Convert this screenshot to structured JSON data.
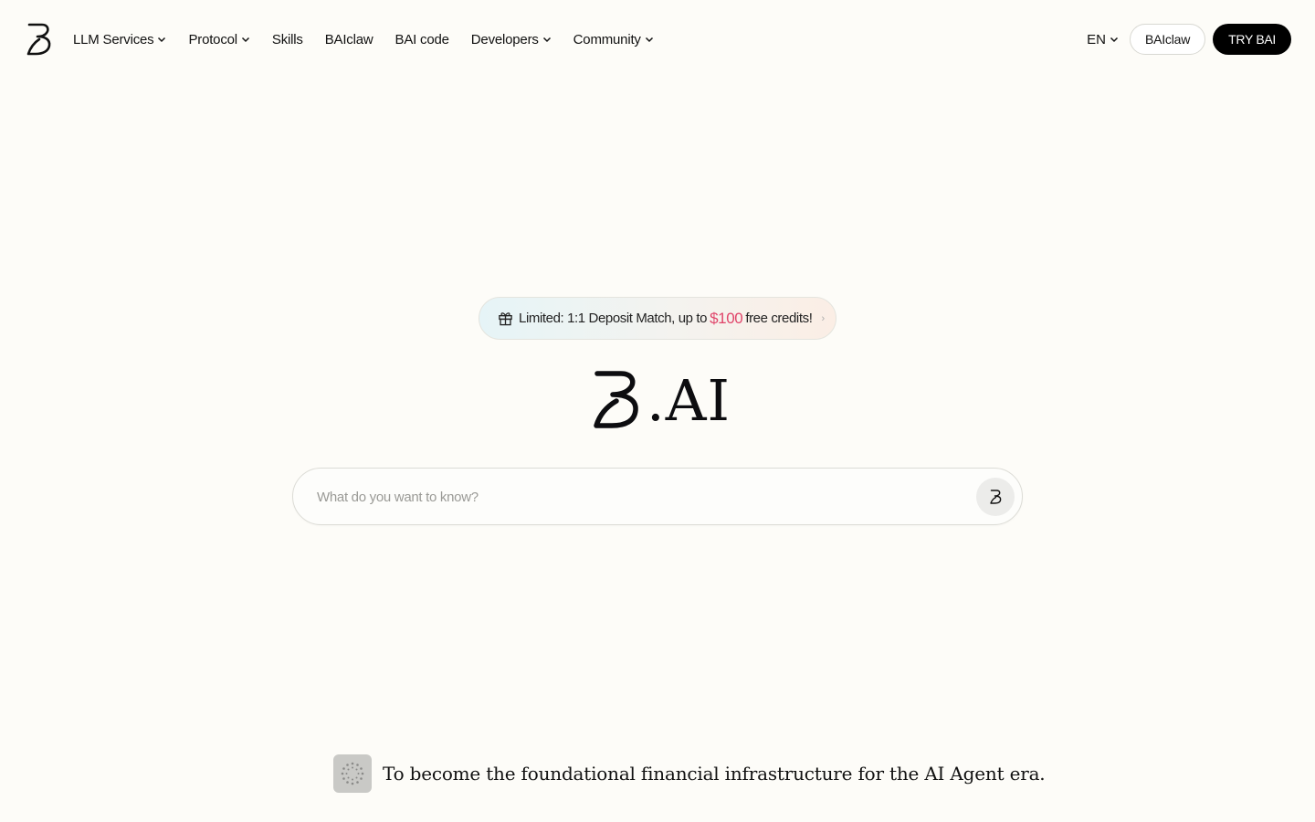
{
  "header": {
    "logo_icon": "b-logo-icon",
    "nav": [
      {
        "label": "LLM Services",
        "dropdown": true
      },
      {
        "label": "Protocol",
        "dropdown": true
      },
      {
        "label": "Skills",
        "dropdown": false
      },
      {
        "label": "BAIclaw",
        "dropdown": false
      },
      {
        "label": "BAI code",
        "dropdown": false
      },
      {
        "label": "Developers",
        "dropdown": true
      },
      {
        "label": "Community",
        "dropdown": true
      }
    ],
    "language": "EN",
    "baiclaw_button": "BAIclaw",
    "try_button": "TRY BAI"
  },
  "promo": {
    "prefix": "Limited: 1:1 Deposit Match, up to",
    "amount": "$100",
    "suffix": "free credits!",
    "icon": "gift-icon",
    "arrow_icon": "chevron-right-icon",
    "amount_color": "#e0456a"
  },
  "brand": {
    "text": ".AI",
    "icon": "b-logo-icon"
  },
  "search": {
    "placeholder": "What do you want to know?",
    "value": "",
    "submit_icon": "b-logo-icon"
  },
  "tagline": {
    "text": "To become the foundational financial infrastructure for the AI Agent era.",
    "icon": "loading-spinner-icon"
  }
}
